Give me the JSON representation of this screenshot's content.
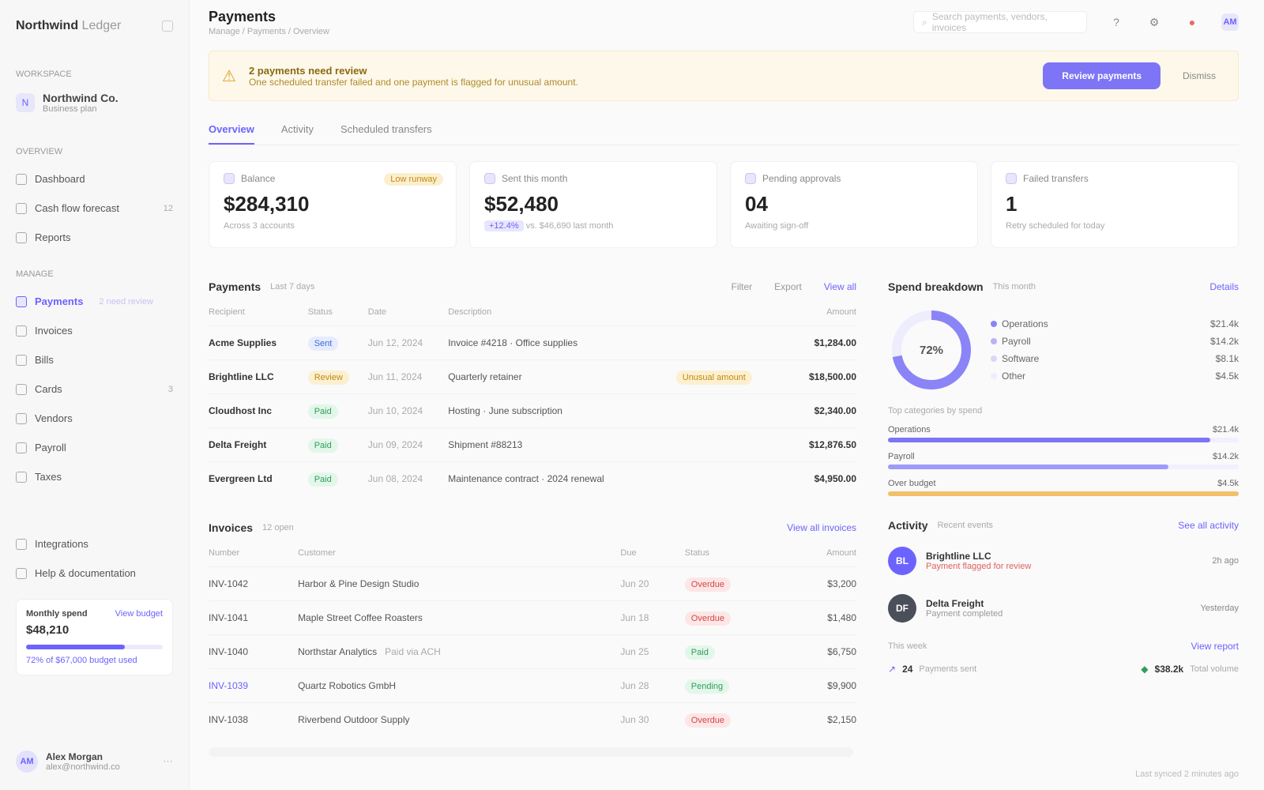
{
  "app": {
    "name": "Northwind",
    "name_light": "Ledger"
  },
  "sidebar": {
    "workspace_label": "WORKSPACE",
    "workspace_icon": "N",
    "workspace_name": "Northwind Co.",
    "workspace_sub": "Business plan",
    "groups": [
      {
        "title": "OVERVIEW",
        "items": [
          {
            "label": "Dashboard",
            "icon": "home-icon"
          },
          {
            "label": "Cash flow forecast",
            "icon": "chart-icon",
            "right": "12"
          },
          {
            "label": "Reports",
            "icon": "file-icon"
          }
        ]
      },
      {
        "title": "MANAGE",
        "items": [
          {
            "label": "Payments",
            "icon": "card-icon",
            "active": true,
            "hint": "2 need review"
          },
          {
            "label": "Invoices",
            "icon": "invoice-icon"
          },
          {
            "label": "Bills",
            "icon": "bill-icon"
          },
          {
            "label": "Cards",
            "icon": "cards-icon",
            "right": "3"
          },
          {
            "label": "Vendors",
            "icon": "vendor-icon"
          },
          {
            "label": "Payroll",
            "icon": "payroll-icon"
          },
          {
            "label": "Taxes",
            "icon": "tax-icon"
          }
        ]
      }
    ],
    "bottom_links": [
      {
        "label": "Integrations",
        "icon": "plug-icon"
      },
      {
        "label": "Help & documentation",
        "icon": "help-icon"
      }
    ],
    "usage": {
      "title": "Monthly spend",
      "link": "View budget",
      "amount": "$48,210",
      "progress": 0.72,
      "meta": "72% of $67,000 budget used"
    },
    "user": {
      "initials": "AM",
      "name": "Alex Morgan",
      "email": "alex@northwind.co"
    }
  },
  "header": {
    "title": "Payments",
    "breadcrumb": "Manage / Payments / Overview",
    "search_placeholder": "Search payments, vendors, invoices",
    "user_initials": "AM"
  },
  "banner": {
    "title": "2 payments need review",
    "subtitle": "One scheduled transfer failed and one payment is flagged for unusual amount.",
    "primary": "Review payments",
    "secondary": "Dismiss"
  },
  "tabs": [
    {
      "label": "Overview",
      "active": true
    },
    {
      "label": "Activity"
    },
    {
      "label": "Scheduled transfers"
    }
  ],
  "kpis": [
    {
      "label": "Balance",
      "value": "$284,310",
      "sub": "Across 3 accounts",
      "badge": "Low runway"
    },
    {
      "label": "Sent this month",
      "value": "$52,480",
      "tag": "+12.4%",
      "sub": "vs. $46,690 last month"
    },
    {
      "label": "Pending approvals",
      "value": "04",
      "sub": "Awaiting sign-off"
    },
    {
      "label": "Failed transfers",
      "value": "1",
      "sub": "Retry scheduled for today"
    }
  ],
  "payments": {
    "title": "Payments",
    "subtitle": "Last 7 days",
    "filter": "Filter",
    "export": "Export",
    "view_all": "View all",
    "columns": [
      "Recipient",
      "Status",
      "Date",
      "Description",
      "",
      "Amount"
    ],
    "rows": [
      {
        "recipient": "Acme Supplies",
        "status": "Sent",
        "status_color": "blue",
        "date": "Jun 12, 2024",
        "description": "Invoice #4218 · Office supplies",
        "flag": "",
        "amount": "$1,284.00"
      },
      {
        "recipient": "Brightline LLC",
        "status": "Review",
        "status_color": "amber",
        "date": "Jun 11, 2024",
        "description": "Quarterly retainer",
        "flag": "Unusual amount",
        "amount": "$18,500.00"
      },
      {
        "recipient": "Cloudhost Inc",
        "status": "Paid",
        "status_color": "green",
        "date": "Jun 10, 2024",
        "description": "Hosting · June subscription",
        "flag": "",
        "amount": "$2,340.00"
      },
      {
        "recipient": "Delta Freight",
        "status": "Paid",
        "status_color": "green",
        "date": "Jun 09, 2024",
        "description": "Shipment #88213",
        "flag": "",
        "amount": "$12,876.50"
      },
      {
        "recipient": "Evergreen Ltd",
        "status": "Paid",
        "status_color": "green",
        "date": "Jun 08, 2024",
        "description": "Maintenance contract · 2024 renewal",
        "flag": "",
        "amount": "$4,950.00"
      }
    ]
  },
  "invoices": {
    "title": "Invoices",
    "count": "12 open",
    "view_all": "View all invoices",
    "columns": [
      "Number",
      "Customer",
      "Due",
      "Status",
      "Amount"
    ],
    "rows": [
      {
        "number": "INV-1042",
        "customer": "Harbor & Pine Design Studio",
        "due": "Jun 20",
        "status": "Overdue",
        "status_color": "red",
        "amount": "$3,200"
      },
      {
        "number": "INV-1041",
        "customer": "Maple Street Coffee Roasters",
        "due": "Jun 18",
        "status": "Overdue",
        "status_color": "red",
        "amount": "$1,480"
      },
      {
        "number": "INV-1040",
        "customer": "Northstar Analytics",
        "due": "Jun 25",
        "status": "Paid",
        "status_color": "green",
        "amount": "$6,750",
        "note": "Paid via ACH"
      },
      {
        "number": "INV-1039",
        "customer": "Quartz Robotics GmbH",
        "due": "Jun 28",
        "status": "Pending",
        "status_color": "green",
        "amount": "$9,900",
        "link": true
      },
      {
        "number": "INV-1038",
        "customer": "Riverbend Outdoor Supply",
        "due": "Jun 30",
        "status": "Overdue",
        "status_color": "red",
        "amount": "$2,150"
      }
    ]
  },
  "breakdown": {
    "title": "Spend breakdown",
    "subtitle": "This month",
    "link": "Details",
    "center": "72%",
    "legend": [
      {
        "label": "Operations",
        "color": "#8b84f7",
        "value": "$21.4k"
      },
      {
        "label": "Payroll",
        "color": "#b7b2fa",
        "value": "$14.2k"
      },
      {
        "label": "Software",
        "color": "#d9d6fc",
        "value": "$8.1k"
      },
      {
        "label": "Other",
        "color": "#eeedfd",
        "value": "$4.5k"
      }
    ],
    "bars_title": "Top categories by spend",
    "bars": [
      {
        "label": "Operations",
        "value": "$21.4k",
        "fraction": 0.92,
        "color": "#7d75f5"
      },
      {
        "label": "Payroll",
        "value": "$14.2k",
        "fraction": 0.8,
        "color": "#9f99f8"
      },
      {
        "label": "Over budget",
        "value": "$4.5k",
        "fraction": 1.0,
        "color": "#f2c06a"
      }
    ]
  },
  "activity": {
    "title": "Activity",
    "subtitle": "Recent events",
    "link": "See all activity",
    "items": [
      {
        "initials": "BL",
        "color": "#6c63ff",
        "line1": "Brightline LLC",
        "line2": "Payment flagged for review",
        "right": "2h ago"
      },
      {
        "initials": "DF",
        "color": "#4a4f5a",
        "line1": "Delta Freight",
        "line2": "Payment completed",
        "right": "Yesterday"
      }
    ],
    "stats_title": "This week",
    "stats_link": "View report",
    "stats": [
      {
        "value": "24",
        "label": "Payments sent"
      },
      {
        "value": "$38.2k",
        "label": "Total volume"
      }
    ]
  },
  "footer": {
    "note": "Last synced 2 minutes ago"
  }
}
